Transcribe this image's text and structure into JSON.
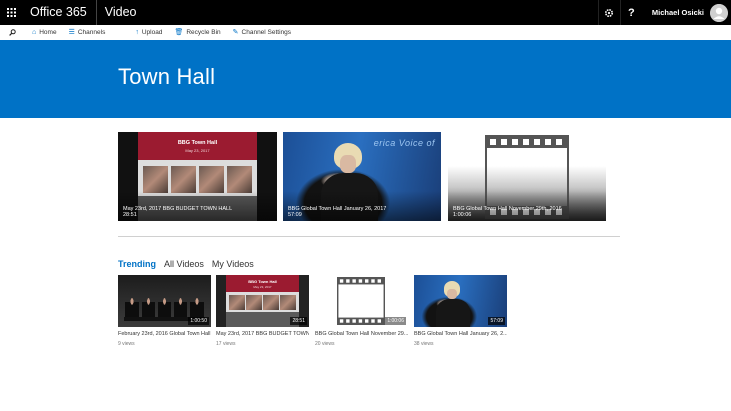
{
  "suite": {
    "brand": "Office 365",
    "app": "Video",
    "user": "Michael Osicki",
    "icons": [
      "waffle-icon",
      "gear-icon",
      "help-icon",
      "avatar-icon"
    ],
    "help_label": "?"
  },
  "commands": {
    "home": "Home",
    "channels": "Channels",
    "upload": "Upload",
    "recycle": "Recycle Bin",
    "settings": "Channel Settings"
  },
  "banner": {
    "title": "Town Hall",
    "color": "#0072c6"
  },
  "featured": [
    {
      "title": "May 23rd, 2017 BBG BUDGET TOWN HALL",
      "duration": "28:51",
      "slide_title": "BBG Town Hall",
      "slide_date": "May 23, 2017"
    },
    {
      "title": "BBG Global Town Hall January 26, 2017",
      "duration": "57:09",
      "overlay_text": "erica  Voice of"
    },
    {
      "title": "BBG Global Town Hall November 29th, 2016",
      "duration": "1:00:06"
    }
  ],
  "tabs": [
    {
      "label": "Trending",
      "active": true
    },
    {
      "label": "All Videos",
      "active": false
    },
    {
      "label": "My Videos",
      "active": false
    }
  ],
  "videos": [
    {
      "title": "February 23rd, 2016 Global Town Hall",
      "duration": "1:00:50",
      "views": "9 views"
    },
    {
      "title": "May 23rd, 2017 BBG BUDGET TOWN H...",
      "duration": "28:51",
      "views": "17 views",
      "slide_title": "BBG Town Hall",
      "slide_date": "May 23, 2017"
    },
    {
      "title": "BBG Global Town Hall November 29...",
      "duration": "1:00:06",
      "views": "20 views"
    },
    {
      "title": "BBG Global Town Hall January 26, 2...",
      "duration": "57:09",
      "views": "38 views"
    }
  ]
}
